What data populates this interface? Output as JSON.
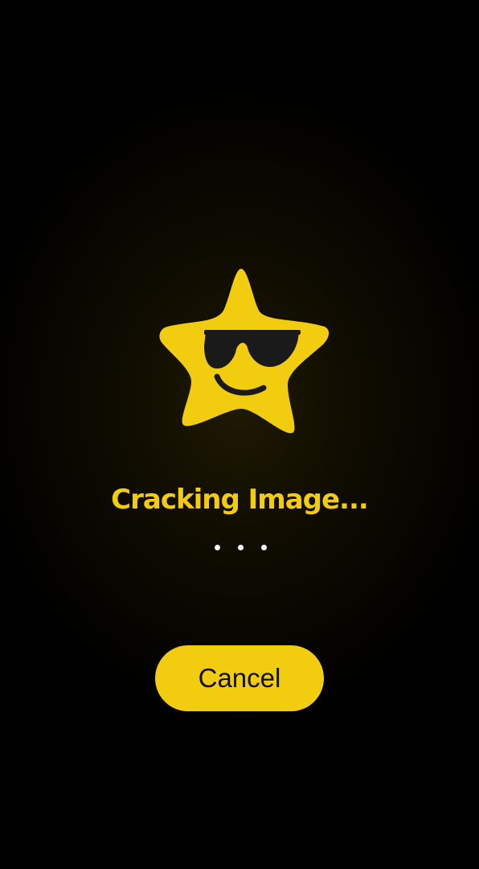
{
  "colors": {
    "accent": "#f2cd0f",
    "background": "#000000",
    "shades": "#1a1a1a",
    "dots": "#ffffff"
  },
  "logo": {
    "icon": "cool-star-with-sunglasses-icon"
  },
  "status": {
    "title": "Cracking Image...",
    "indicator_icon": "loading-dots-icon"
  },
  "actions": {
    "cancel_label": "Cancel"
  }
}
